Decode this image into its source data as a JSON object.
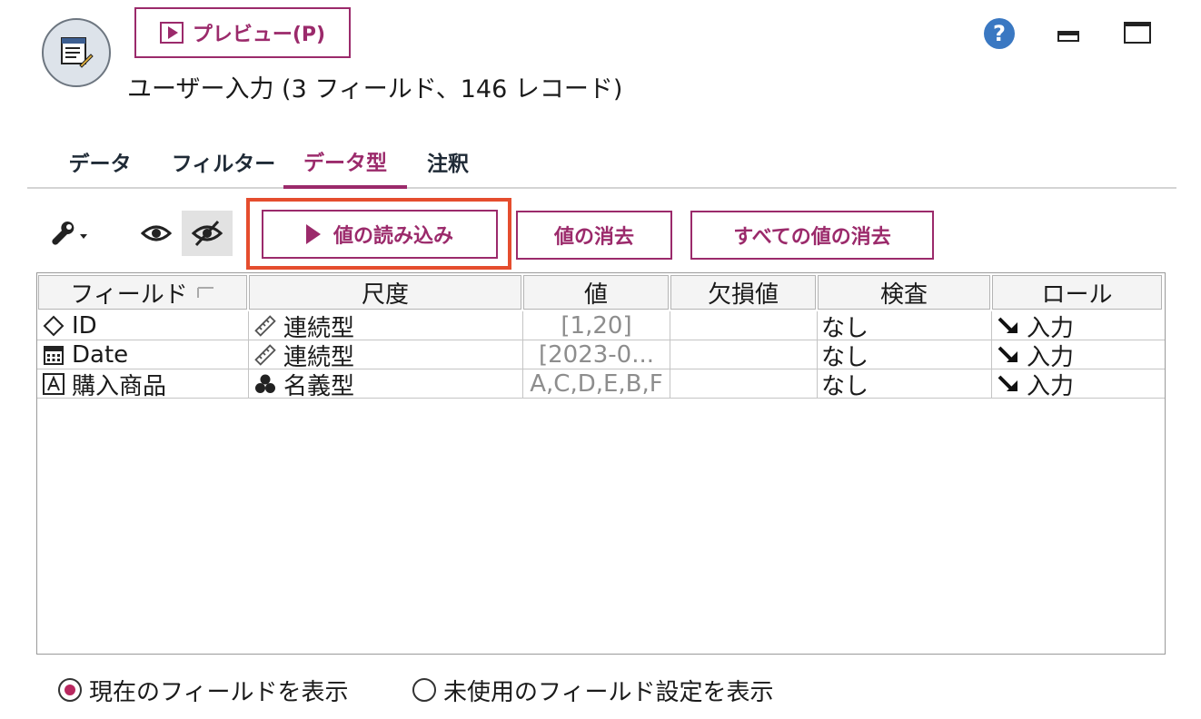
{
  "header": {
    "preview_label": "プレビュー(P)",
    "title": "ユーザー入力 (3 フィールド、146 レコード)",
    "help_glyph": "?"
  },
  "tabs": [
    {
      "label": "データ",
      "active": false
    },
    {
      "label": "フィルター",
      "active": false
    },
    {
      "label": "データ型",
      "active": true
    },
    {
      "label": "注釈",
      "active": false
    }
  ],
  "toolbar": {
    "read_values_label": "値の読み込み",
    "clear_values_label": "値の消去",
    "clear_all_values_label": "すべての値の消去"
  },
  "table": {
    "columns": [
      "フィールド",
      "尺度",
      "値",
      "欠損値",
      "検査",
      "ロール"
    ],
    "rows": [
      {
        "field": "ID",
        "field_icon": "continuous-field-icon",
        "measure": "連続型",
        "measure_icon": "ruler-icon",
        "values": "[1,20]",
        "missing": "",
        "check": "なし",
        "role": "入力",
        "role_icon": "input-arrow-icon"
      },
      {
        "field": "Date",
        "field_icon": "calendar-icon",
        "measure": "連続型",
        "measure_icon": "ruler-icon",
        "values": "[2023-0...",
        "missing": "",
        "check": "なし",
        "role": "入力",
        "role_icon": "input-arrow-icon"
      },
      {
        "field": "購入商品",
        "field_icon": "string-field-icon",
        "measure": "名義型",
        "measure_icon": "nominal-icon",
        "values": "A,C,D,E,B,F",
        "missing": "",
        "check": "なし",
        "role": "入力",
        "role_icon": "input-arrow-icon"
      }
    ]
  },
  "footer": {
    "show_current_label": "現在のフィールドを表示",
    "show_unused_label": "未使用のフィールド設定を表示",
    "selected": "show_current"
  },
  "colors": {
    "accent": "#9b2a6b",
    "highlight_border": "#e54d2e",
    "help_blue": "#3a78c2"
  }
}
